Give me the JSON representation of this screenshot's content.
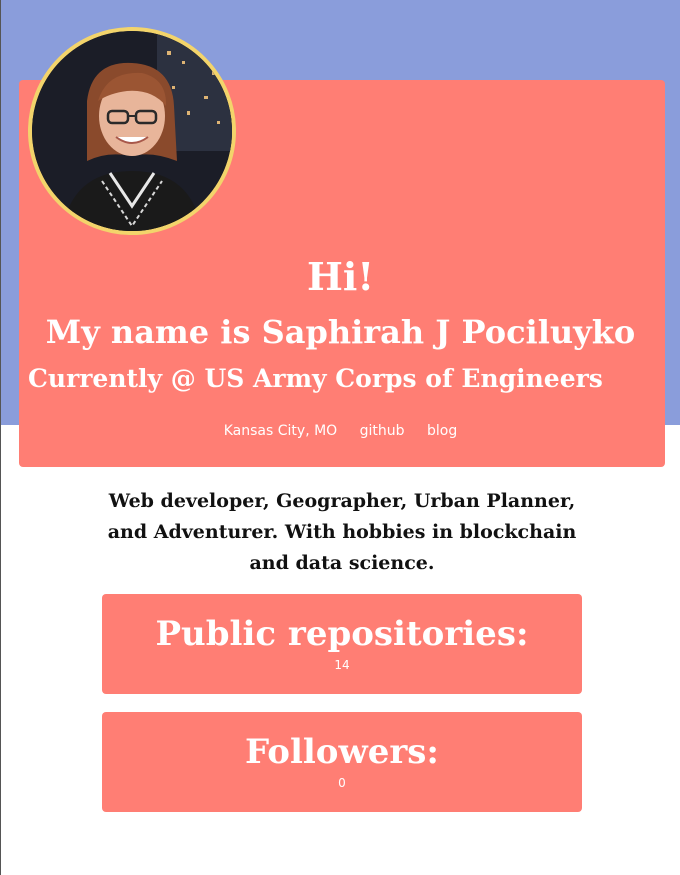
{
  "header": {
    "greeting": "Hi!",
    "name_line": "My name is Saphirah J Pociluyko",
    "current_line": "Currently @ US Army Corps of Engineers"
  },
  "links": {
    "location": "Kansas City, MO",
    "github": "github",
    "blog": "blog"
  },
  "bio": "Web developer, Geographer, Urban Planner, and Adventurer. With hobbies in blockchain and data science.",
  "stats": {
    "repos_label": "Public repositories:",
    "repos_value": "14",
    "followers_label": "Followers:",
    "followers_value": "0"
  },
  "colors": {
    "background_top": "#8a9ddb",
    "card": "#ff7e74",
    "avatar_border": "#f3d46b"
  }
}
